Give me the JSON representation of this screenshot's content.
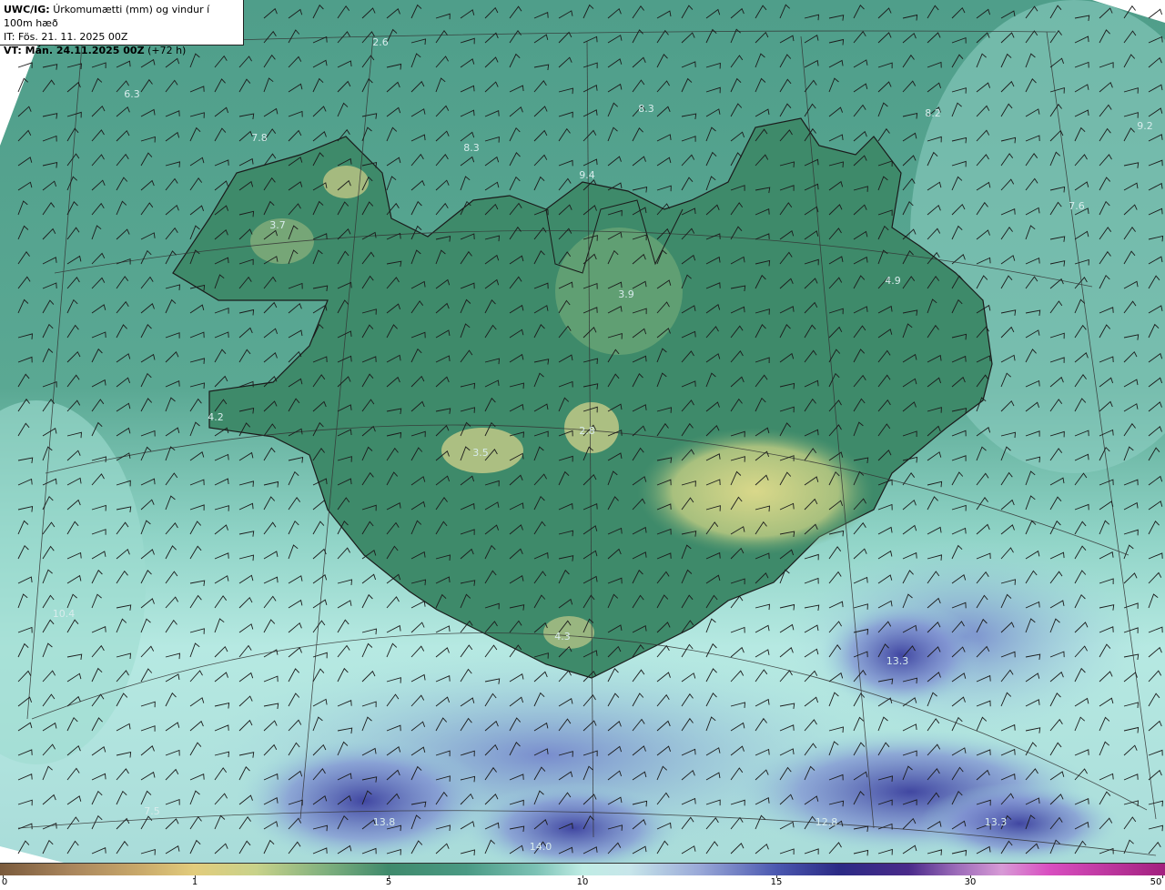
{
  "header": {
    "model": "UWC/IG:",
    "title": "Úrkomumætti (mm) og vindur í 100m hæð",
    "issue_time": "IT: Fös. 21. 11. 2025 00Z",
    "valid_prefix": "VT: Mán. 24.11.2025 00Z",
    "valid_offset": "(+72 h)"
  },
  "labels": [
    {
      "text": "2.6"
    },
    {
      "text": "6.3"
    },
    {
      "text": "7.8"
    },
    {
      "text": "8.3"
    },
    {
      "text": "8.3"
    },
    {
      "text": "9.4"
    },
    {
      "text": "8.2"
    },
    {
      "text": "9.2"
    },
    {
      "text": "7.6"
    },
    {
      "text": "4.9"
    },
    {
      "text": "3.7"
    },
    {
      "text": "3.9"
    },
    {
      "text": "4.2"
    },
    {
      "text": "2.8"
    },
    {
      "text": "3.5"
    },
    {
      "text": "10.4"
    },
    {
      "text": "4.3"
    },
    {
      "text": "13.3"
    },
    {
      "text": "7.5"
    },
    {
      "text": "13.8"
    },
    {
      "text": "14.0"
    },
    {
      "text": "12.8"
    },
    {
      "text": "13.3"
    }
  ],
  "colorbar": {
    "ticks": [
      "0",
      "1",
      "5",
      "10",
      "15",
      "30",
      "50"
    ],
    "colors": {
      "low": "#7a5a3c",
      "mid": "#3f8a6c",
      "high_water": "#bfece4",
      "blue": "#2b2a85",
      "max": "#a2207e"
    }
  }
}
